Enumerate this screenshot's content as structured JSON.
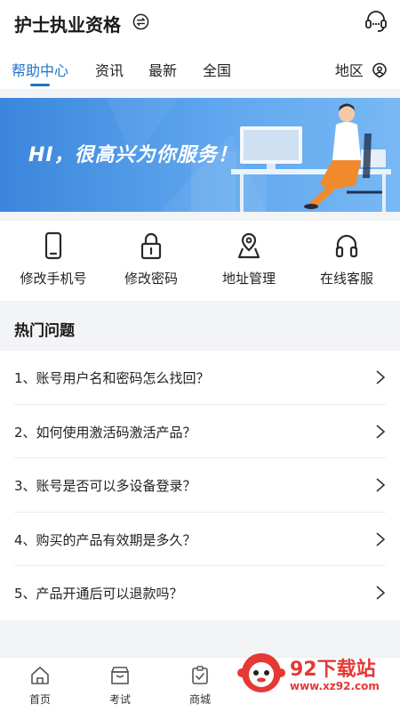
{
  "header": {
    "title": "护士执业资格",
    "switch_icon": "swap-circle-icon",
    "service_icon": "headset-service-icon"
  },
  "tabs": [
    {
      "label": "帮助中心",
      "active": true
    },
    {
      "label": "资讯",
      "active": false
    },
    {
      "label": "最新",
      "active": false
    },
    {
      "label": "全国",
      "active": false
    }
  ],
  "region": {
    "label": "地区",
    "icon": "location-person-icon"
  },
  "banner": {
    "text": "HI，很高兴为你服务！"
  },
  "quick_actions": [
    {
      "label": "修改手机号",
      "icon": "phone-icon"
    },
    {
      "label": "修改密码",
      "icon": "lock-icon"
    },
    {
      "label": "地址管理",
      "icon": "map-pin-icon"
    },
    {
      "label": "在线客服",
      "icon": "headphones-icon"
    }
  ],
  "hot_questions": {
    "title": "热门问题",
    "items": [
      "1、账号用户名和密码怎么找回？",
      "2、如何使用激活码激活产品？",
      "3、账号是否可以多设备登录？",
      "4、购买的产品有效期是多久？",
      "5、产品开通后可以退款吗？"
    ]
  },
  "bottom_nav": [
    {
      "label": "首页",
      "icon": "home-icon"
    },
    {
      "label": "考试",
      "icon": "exam-box-icon"
    },
    {
      "label": "商城",
      "icon": "clipboard-check-icon"
    }
  ],
  "watermark": {
    "text": "92下载站",
    "url": "www.xz92.com"
  },
  "colors": {
    "accent": "#1f74c7",
    "banner": "#4a95e4",
    "watermark": "#e53935"
  }
}
